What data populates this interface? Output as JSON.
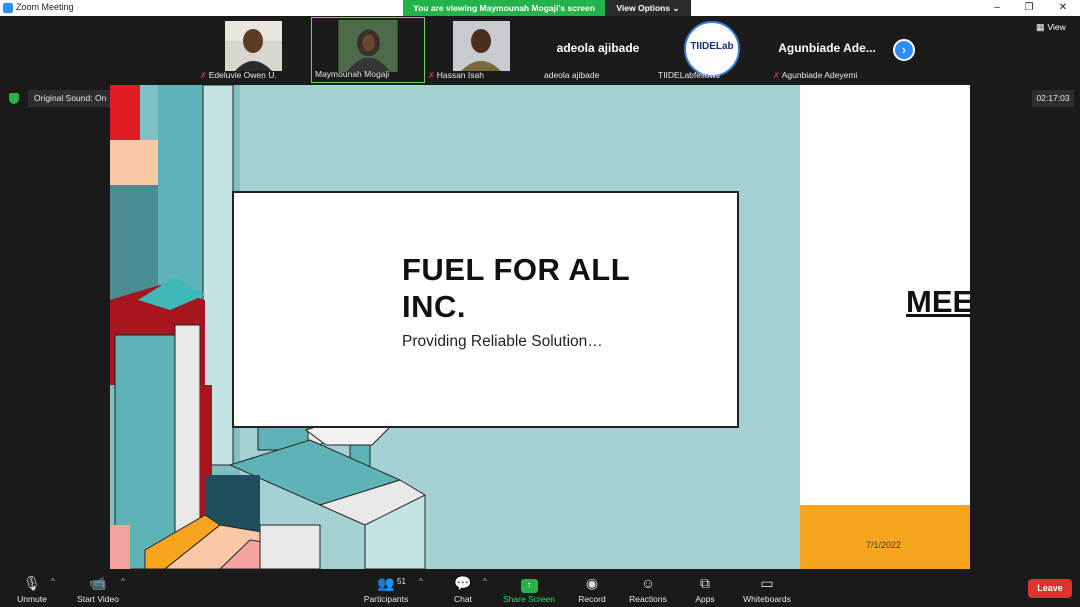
{
  "window": {
    "title": "Zoom Meeting"
  },
  "share_banner": {
    "message": "You are viewing Maymounah Mogaji's screen",
    "view_options": "View Options ⌄"
  },
  "window_controls": {
    "minimize": "–",
    "maximize": "❐",
    "close": "✕"
  },
  "gallery": {
    "participants": [
      {
        "name": "Edeluvie Owen U.",
        "muted": true,
        "video": true
      },
      {
        "name": "Maymounah Mogaji",
        "muted": false,
        "video": true,
        "active_speaker": true
      },
      {
        "name": "Hassan Isah",
        "muted": true,
        "video": true
      },
      {
        "name": "adeola ajibade",
        "display_name": "adeola ajibade",
        "muted": false,
        "video": false
      },
      {
        "name": "TIIDELabfellows",
        "logo_text": "TIIDELab",
        "muted": false,
        "video": false
      },
      {
        "name": "Agunbiade Adeyemi",
        "display_name": "Agunbiade Ade...",
        "muted": true,
        "video": false
      }
    ],
    "next_icon": "›",
    "view_label": "View"
  },
  "audio": {
    "original_sound": "Original Sound: On",
    "dropdown": "▾"
  },
  "timer": "02:17:03",
  "slide": {
    "title_line1": "FUEL FOR ALL",
    "title_line2": "INC.",
    "subtitle": "Providing Reliable Solution…",
    "next_title_partial": "MEE",
    "date": "7/1/2022"
  },
  "toolbar": {
    "unmute": "Unmute",
    "start_video": "Start Video",
    "participants": "Participants",
    "participant_count": "51",
    "chat": "Chat",
    "share_screen": "Share Screen",
    "record": "Record",
    "reactions": "Reactions",
    "apps": "Apps",
    "whiteboards": "Whiteboards",
    "leave": "Leave",
    "caret": "^"
  },
  "colors": {
    "accent": "#2d8cff",
    "share_green": "#24b24a",
    "leave_red": "#e0312f",
    "slide_teal": "#a5d1d3",
    "slide_orange": "#f7a51e"
  }
}
